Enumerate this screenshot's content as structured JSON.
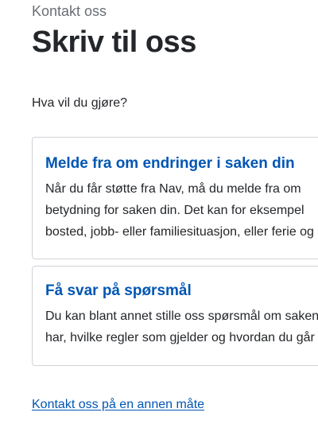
{
  "header": {
    "eyebrow": "Kontakt oss",
    "title": "Skriv til oss"
  },
  "question": "Hva vil du gjøre?",
  "cards": [
    {
      "title": "Melde fra om endringer i saken din",
      "lines": [
        "Når du får støtte fra Nav, må du melde fra om",
        "betydning for saken din. Det kan for eksempel",
        "bosted, jobb- eller familiesituasjon, eller ferie og"
      ]
    },
    {
      "title": "Få svar på spørsmål",
      "lines": [
        "Du kan blant annet stille oss spørsmål om saken",
        "har, hvilke regler som gjelder og hvordan du går"
      ]
    }
  ],
  "footer_link": "Kontakt oss på en annen måte",
  "colors": {
    "link": "#0056b4",
    "text": "#23262a",
    "muted": "#6a6f75",
    "border": "#cfd3d8"
  }
}
